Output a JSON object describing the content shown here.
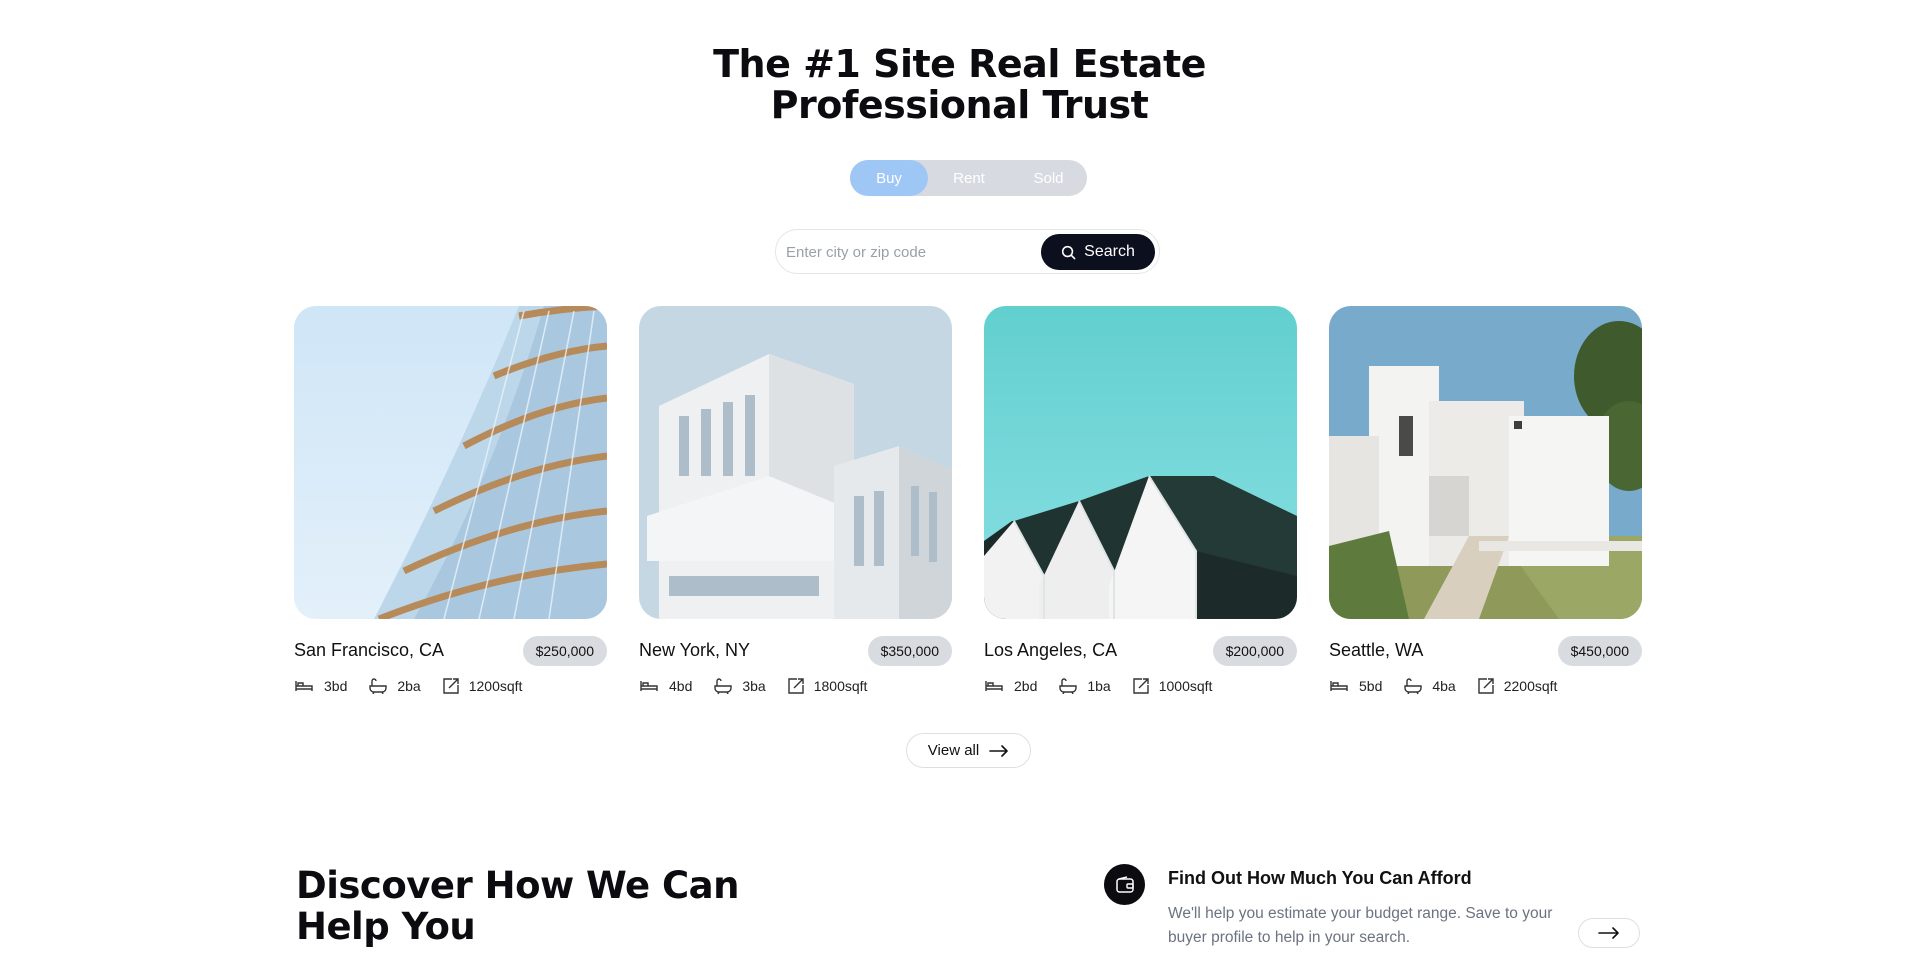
{
  "hero": {
    "title_line1": "The #1 Site Real Estate",
    "title_line2": "Professional Trust"
  },
  "toggle": {
    "options": [
      "Buy",
      "Rent",
      "Sold"
    ],
    "selected": "Buy"
  },
  "search": {
    "placeholder": "Enter city or zip code",
    "button_label": "Search"
  },
  "listings": [
    {
      "city": "San Francisco, CA",
      "price": "$250,000",
      "beds": "3bd",
      "baths": "2ba",
      "area": "1200sqft"
    },
    {
      "city": "New York, NY",
      "price": "$350,000",
      "beds": "4bd",
      "baths": "3ba",
      "area": "1800sqft"
    },
    {
      "city": "Los Angeles, CA",
      "price": "$200,000",
      "beds": "2bd",
      "baths": "1ba",
      "area": "1000sqft"
    },
    {
      "city": "Seattle, WA",
      "price": "$450,000",
      "beds": "5bd",
      "baths": "4ba",
      "area": "2200sqft"
    }
  ],
  "view_all": {
    "label": "View all"
  },
  "discover": {
    "title_line1": "Discover How We Can",
    "title_line2": "Help You"
  },
  "afford": {
    "title": "Find Out How Much You Can Afford",
    "description": "We'll help you estimate your budget range. Save to your buyer profile to help in your search."
  },
  "colors": {
    "toggle_active": "#9fc7f6",
    "toggle_track": "#d7dbe1",
    "search_button": "#0c0f1e",
    "price_badge": "#d8dbe0"
  }
}
